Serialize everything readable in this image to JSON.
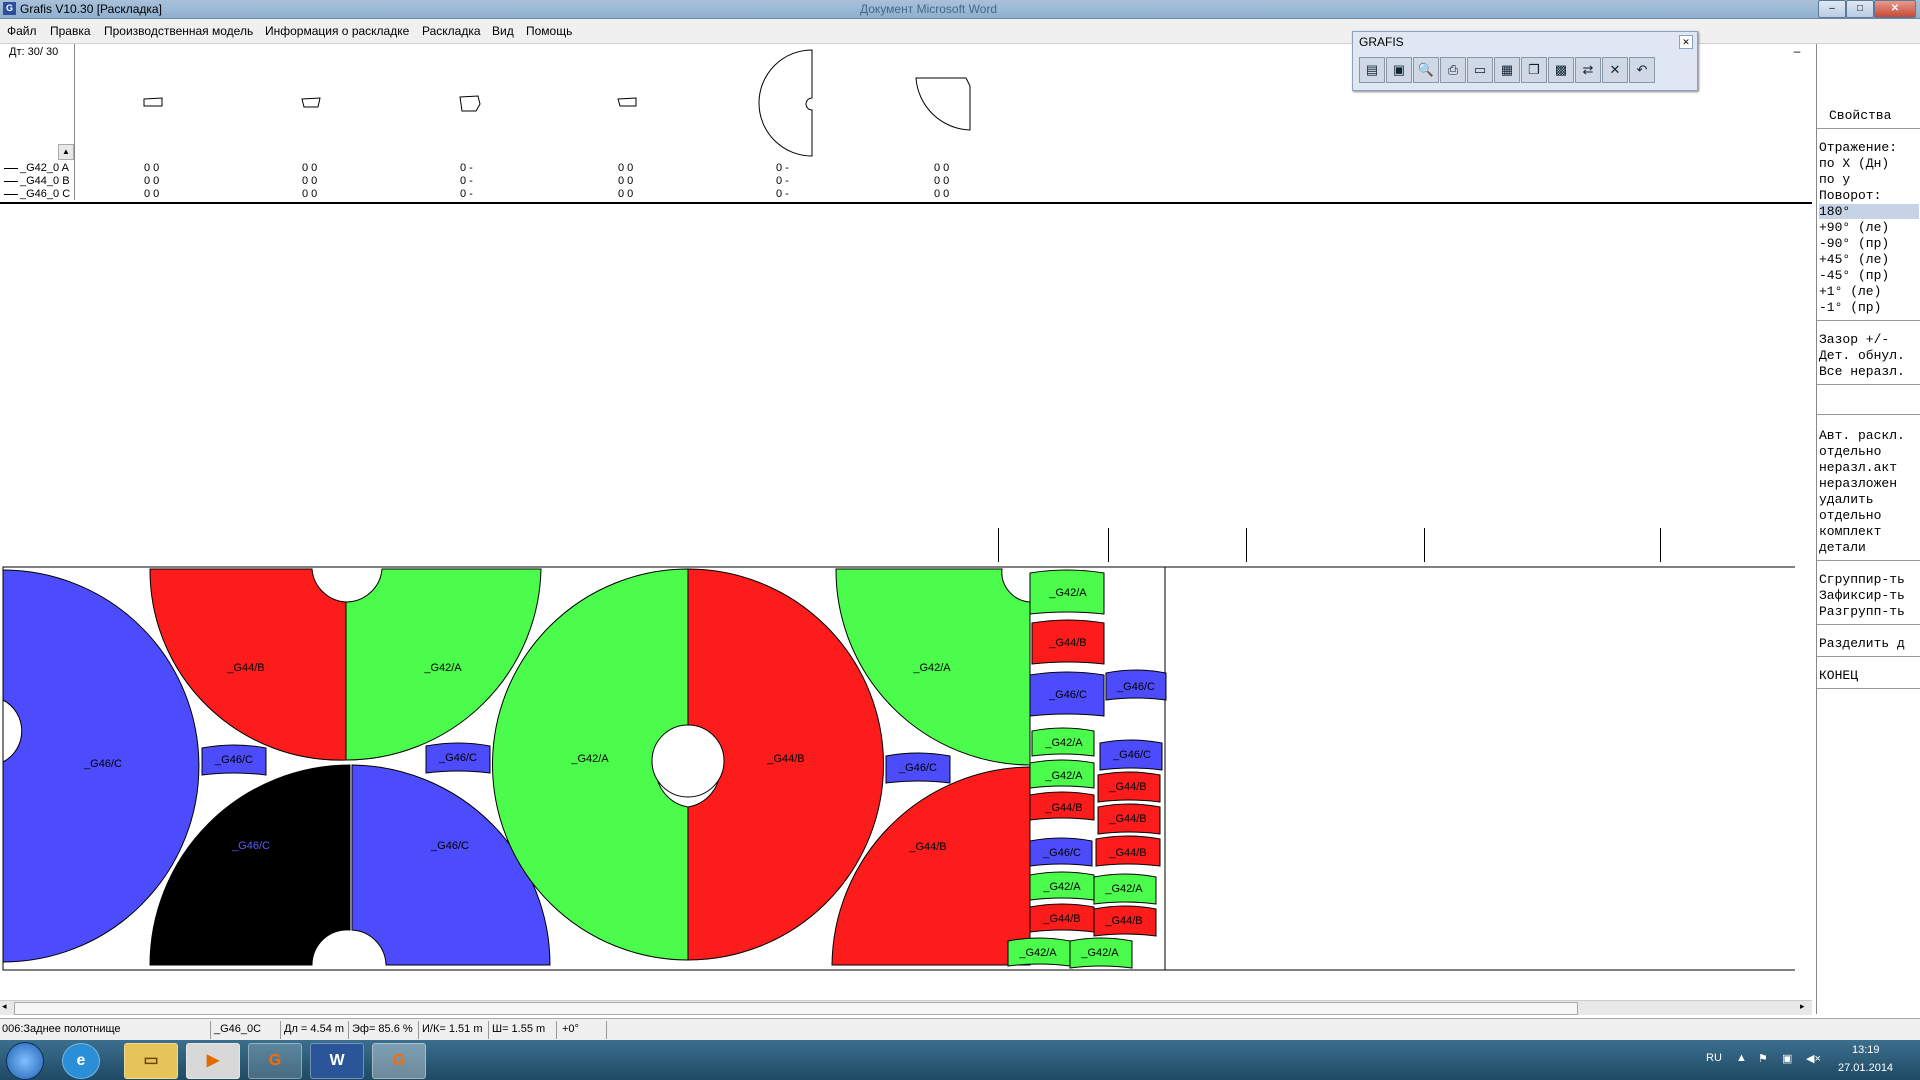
{
  "window": {
    "title": "Grafis V10.30 [Раскладка]",
    "background_title": "Документ Microsoft Word"
  },
  "menu": [
    "Файл",
    "Правка",
    "Производственная модель",
    "Информация о раскладке",
    "Раскладка",
    "Вид",
    "Помощь"
  ],
  "pieces_panel": {
    "count": "Дт: 30/  30",
    "rows": [
      {
        "code": "_G42_0",
        "letter": "A"
      },
      {
        "code": "_G44_0",
        "letter": "B"
      },
      {
        "code": "_G46_0",
        "letter": "C"
      }
    ],
    "columns": [
      [
        "0  0",
        "0  0",
        "0  0"
      ],
      [
        "0  0",
        "0  0",
        "0  0"
      ],
      [
        "0  -",
        "0  -",
        "0  -"
      ],
      [
        "0  0",
        "0  0",
        "0  0"
      ],
      [
        "0  -",
        "0  -",
        "0  -"
      ],
      [
        "0  0",
        "0  0",
        "0  0"
      ]
    ]
  },
  "toolbar": {
    "title": "GRAFIS",
    "buttons": [
      "open-icon",
      "save-icon",
      "zoom-icon",
      "print-icon",
      "measure-icon",
      "sheet-icon",
      "copy-icon",
      "grid-icon",
      "nest-icon",
      "close-icon",
      "undo-icon"
    ],
    "glyphs": [
      "▤",
      "▣",
      "🔍",
      "⎙",
      "▭",
      "▦",
      "❐",
      "▩",
      "⇄",
      "✕",
      "↶"
    ]
  },
  "sidebar": {
    "properties": "Свойства",
    "mirror": "Отражение:",
    "mirror_x": " по X (Дн)",
    "mirror_y": " по у",
    "rotation": "Поворот:",
    "rot": [
      "  180°",
      " +90° (ле)",
      " -90° (пр)",
      " +45° (ле)",
      " -45° (пр)",
      "  +1° (ле)",
      "  -1° (пр)"
    ],
    "gap": "Зазор +/-",
    "zero": "Дет. обнул.",
    "all_unplaced": "Все неразл.",
    "auto": "Авт. раскл.",
    "auto_items": [
      " отдельно",
      " неразл.акт",
      " неразложен"
    ],
    "delete": "удалить",
    "delete_items": [
      " отдельно",
      " комплект",
      " детали"
    ],
    "group": "Сгруппир-ть",
    "fix": "Зафиксир-ть",
    "ungroup": "Разгрупп-ть",
    "split": "Разделить д",
    "end": "КОНЕЦ"
  },
  "pieces": {
    "g42": "_G42/A",
    "g44": "_G44/B",
    "g46": "_G46/C"
  },
  "colors": {
    "g42": "#4cfc4c",
    "g44": "#fc1c1c",
    "g46": "#4c4cfc",
    "selected": "#000000"
  },
  "status": {
    "piece": "006:Заднее полотнище",
    "code": "_G46_0C",
    "length": "Дл = 4.54 m",
    "efficiency": "Эф= 85.6 %",
    "ik": "И/К= 1.51 m",
    "width": "Ш= 1.55 m",
    "angle": "+0°"
  },
  "taskbar": {
    "lang": "RU",
    "time": "13:19",
    "date": "27.01.2014"
  }
}
